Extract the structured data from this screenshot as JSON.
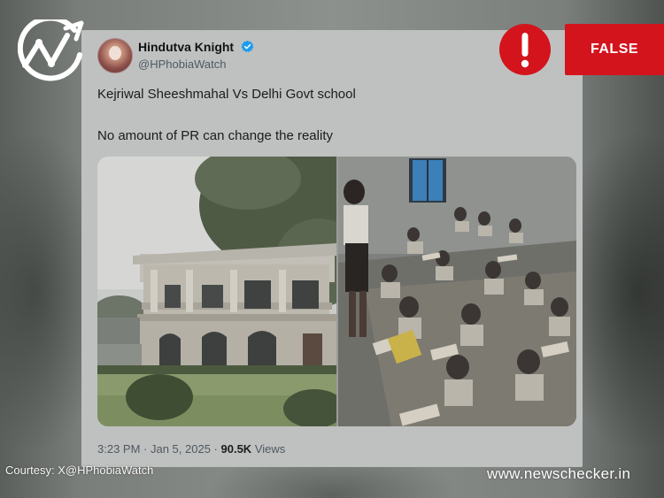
{
  "tweet": {
    "author_name": "Hindutva Knight",
    "handle": "@HPhobiaWatch",
    "text_line1": "Kejriwal Sheeshmahal Vs Delhi Govt school",
    "text_line2": "No amount of PR can change the reality",
    "time": "3:23 PM",
    "separator1": " · ",
    "date": "Jan 5, 2025",
    "separator2": " · ",
    "views_count": "90.5K",
    "views_label": " Views",
    "verified_icon": "verified-badge-icon"
  },
  "media": {
    "left_image": "mansion-photo",
    "right_image": "classroom-photo"
  },
  "overlay": {
    "logo_icon": "newschecker-logo-icon",
    "alert_icon": "exclamation-icon",
    "verdict": "FALSE",
    "verdict_color": "#d3141d",
    "credit": "Courtesy: X@HPhobiaWatch",
    "site": "www.newschecker.in"
  }
}
